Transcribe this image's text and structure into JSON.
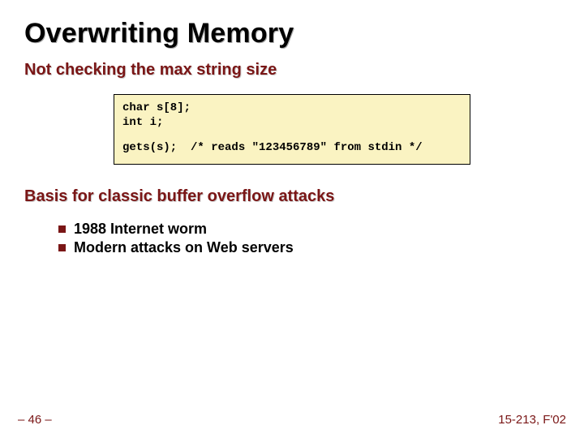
{
  "title": "Overwriting Memory",
  "subhead1": "Not checking the max string size",
  "code": {
    "line1": "char s[8];",
    "line2": "int i;",
    "line3": "gets(s);  /* reads \"123456789\" from stdin */"
  },
  "subhead2": "Basis for classic buffer overflow attacks",
  "bullets": [
    "1988 Internet worm",
    "Modern attacks on Web servers"
  ],
  "footer": {
    "page": "– 46 –",
    "course": "15-213, F'02"
  }
}
